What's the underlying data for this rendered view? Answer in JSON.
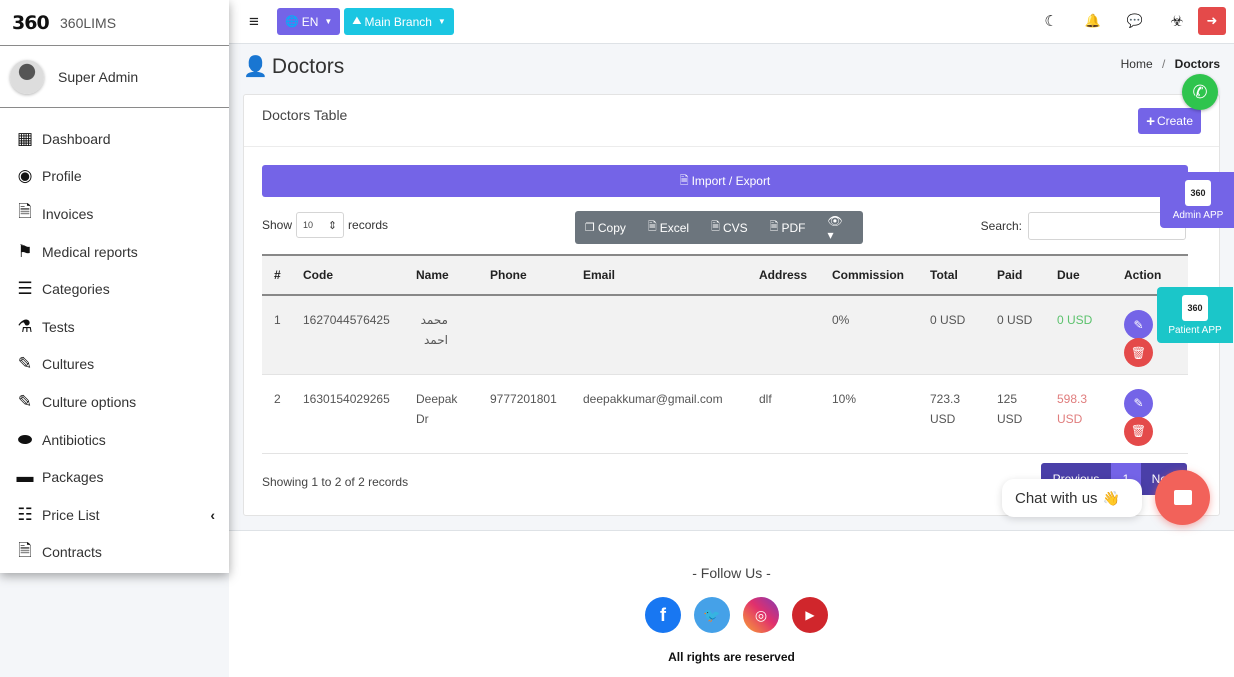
{
  "brand": {
    "logo": "360",
    "name": "360LIMS"
  },
  "user": {
    "name": "Super Admin"
  },
  "sidebar": {
    "items": [
      {
        "label": "Dashboard",
        "icon": "grid-icon",
        "glyph": "▦"
      },
      {
        "label": "Profile",
        "icon": "user-circle-icon",
        "glyph": "◉"
      },
      {
        "label": "Invoices",
        "icon": "invoice-icon",
        "glyph": "🗎"
      },
      {
        "label": "Medical reports",
        "icon": "flag-icon",
        "glyph": "⚑"
      },
      {
        "label": "Categories",
        "icon": "checklist-icon",
        "glyph": "☰"
      },
      {
        "label": "Tests",
        "icon": "flask-icon",
        "glyph": "⚗"
      },
      {
        "label": "Cultures",
        "icon": "vial-icon",
        "glyph": "✎"
      },
      {
        "label": "Culture options",
        "icon": "vial-icon",
        "glyph": "✎"
      },
      {
        "label": "Antibiotics",
        "icon": "pills-icon",
        "glyph": "⬬"
      },
      {
        "label": "Packages",
        "icon": "box-icon",
        "glyph": "▬"
      },
      {
        "label": "Price List",
        "icon": "list-icon",
        "glyph": "☷",
        "chevron": "‹"
      },
      {
        "label": "Contracts",
        "icon": "contract-file-icon",
        "glyph": "🗎"
      }
    ]
  },
  "topbar": {
    "menu_glyph": "≡",
    "language": {
      "label": "EN",
      "glyph": "🌐"
    },
    "branch": {
      "label": "Main Branch",
      "glyph": "⛰"
    },
    "caret": "▼",
    "icons": [
      {
        "name": "moon-icon",
        "glyph": "☾"
      },
      {
        "name": "bell-icon",
        "glyph": "🔔"
      },
      {
        "name": "chat-icon",
        "glyph": "💬"
      },
      {
        "name": "biohazard-icon",
        "glyph": "☣"
      }
    ],
    "logout_glyph": "➜"
  },
  "page": {
    "title": "Doctors",
    "title_glyph": "👤",
    "breadcrumb": {
      "home": "Home",
      "separator": "/",
      "current": "Doctors"
    }
  },
  "card": {
    "title": "Doctors Table",
    "create_label": "Create",
    "create_glyph": "+",
    "import_export_label": "Import / Export",
    "import_glyph": "🗎",
    "length": {
      "show": "Show",
      "value": "10",
      "records": "records",
      "spinner": "⇕"
    },
    "export_buttons": [
      {
        "label": "Copy",
        "glyph": "❐"
      },
      {
        "label": "Excel",
        "glyph": "🗎"
      },
      {
        "label": "CVS",
        "glyph": "🗎"
      },
      {
        "label": "PDF",
        "glyph": "🗎"
      }
    ],
    "visibility_glyph": "👁 ▾",
    "search_label": "Search:",
    "search_value": ""
  },
  "table": {
    "columns": [
      "#",
      "Code",
      "Name",
      "Phone",
      "Email",
      "Address",
      "Commission",
      "Total",
      "Paid",
      "Due",
      "Action"
    ],
    "rows": [
      {
        "num": "1",
        "code": "1627044576425",
        "name": "محمد احمد",
        "phone": "",
        "email": "",
        "address": "",
        "commission": "0%",
        "total": "0 USD",
        "paid": "0 USD",
        "due": "0 USD",
        "due_status": "green"
      },
      {
        "num": "2",
        "code": "1630154029265",
        "name": "Deepak Dr",
        "phone": "9777201801",
        "email": "deepakkumar@gmail.com",
        "address": "dlf",
        "commission": "10%",
        "total": "723.3 USD",
        "paid": "125 USD",
        "due": "598.3 USD",
        "due_status": "red"
      }
    ],
    "edit_glyph": "✎",
    "delete_glyph": "🗑"
  },
  "footer_info": {
    "showing": "Showing 1 to 2 of 2 records",
    "pagination": {
      "previous": "Previous",
      "current": "1",
      "next": "Next"
    }
  },
  "footer": {
    "follow": "- Follow Us -",
    "socials": [
      {
        "name": "facebook-icon",
        "glyph": "f"
      },
      {
        "name": "twitter-icon",
        "glyph": "🐦"
      },
      {
        "name": "instagram-icon",
        "glyph": "◎"
      },
      {
        "name": "youtube-icon",
        "glyph": "▶"
      }
    ],
    "rights": "All rights are reserved"
  },
  "widgets": {
    "whatsapp_glyph": "✆",
    "admin_app": {
      "logo": "360",
      "label": "Admin APP"
    },
    "patient_app": {
      "logo": "360",
      "label": "Patient APP"
    },
    "chat": {
      "label": "Chat with us",
      "emoji": "👋"
    }
  },
  "colors": {
    "primary": "#7464e7",
    "info": "#1bc6e2",
    "danger": "#e44a4a",
    "success_text": "#5cc26d",
    "due_text": "#e07d7d",
    "chat": "#f2625a",
    "whatsapp": "#2fc44d"
  }
}
